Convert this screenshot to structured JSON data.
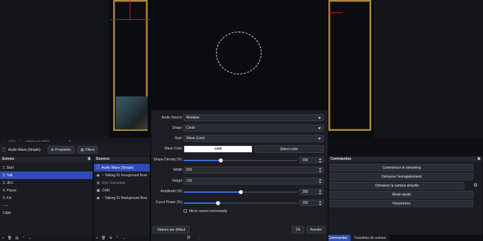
{
  "preview": {
    "red_label": "...",
    "zoom_value": "100%",
    "zoom_fit_label": "Adapter à la fenêtre"
  },
  "source_toolbar": {
    "selected_source": "Audio Wave (Simple)",
    "properties_label": "Propriétés",
    "filters_label": "Filtres"
  },
  "scenes": {
    "title": "Scènes",
    "items": [
      {
        "label": "1. Start",
        "selected": false
      },
      {
        "label": "2. Talk",
        "selected": true
      },
      {
        "label": "3. JEU",
        "selected": false
      },
      {
        "label": "4. Pause",
        "selected": false
      },
      {
        "label": "5. Fin",
        "selected": false
      },
      {
        "label": "-----",
        "selected": false
      },
      {
        "label": "CAM",
        "selected": false
      }
    ]
  },
  "sources": {
    "title": "Sources",
    "items": [
      {
        "label": "Audio Wave (Simple)",
        "selected": true
      },
      {
        "label": "~ Talking 01  Foreground Browser",
        "selected": false
      },
      {
        "label": "Mon Gameplay",
        "selected": false
      },
      {
        "label": "CAM",
        "selected": false
      },
      {
        "label": "~ Talking 01  Background Browser",
        "selected": false
      }
    ]
  },
  "commands": {
    "title": "Commandes",
    "buttons": [
      "Commencer le streaming",
      "Démarrer l'enregistrement",
      "Démarrer la caméra virtuelle",
      "Mode studio",
      "Paramètres"
    ]
  },
  "bottom_tabs": [
    "Commandes",
    "Transition de scènes"
  ],
  "dialog": {
    "audio_source_label": "Audio Source",
    "audio_source_value": "Musique",
    "shape_label": "Shape",
    "shape_value": "Circle",
    "style_label": "Style",
    "style_value": "Wave (Line)",
    "wave_color_label": "Wave Color",
    "wave_color_value": "#ffffff",
    "select_color_label": "Select color",
    "shape_density_label": "Shape Density (%)",
    "shape_density_value": "100",
    "shape_density_level": 0.33,
    "width_label": "Width",
    "width_value": "800",
    "height_label": "Height",
    "height_value": "200",
    "amplitude_label": "Amplitude (%)",
    "amplitude_value": "200",
    "amplitude_level": 0.5,
    "curve_power_label": "Curve Power (%)",
    "curve_power_value": "100",
    "curve_power_level": 0.3,
    "mirror_label": "Mirror waves horizontally",
    "mirror_checked": false,
    "defaults_label": "Valeurs par défaut",
    "ok_label": "Ok",
    "cancel_label": "Annuler"
  },
  "colors": {
    "accent": "#2f4db5",
    "frame_gold": "#b08a3a",
    "slider_blue": "#3f6ae0",
    "red_marker": "#d01818"
  }
}
